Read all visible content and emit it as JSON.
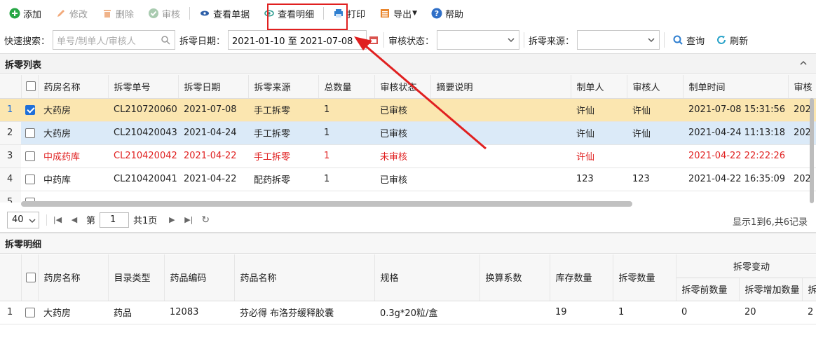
{
  "toolbar": {
    "add": "添加",
    "edit": "修改",
    "delete": "删除",
    "audit": "审核",
    "view_doc": "查看单据",
    "view_detail": "查看明细",
    "print": "打印",
    "export": "导出",
    "help": "帮助"
  },
  "search": {
    "quick_label": "快速搜索：",
    "quick_placeholder": "单号/制单人/审核人",
    "date_label": "拆零日期：",
    "date_value": "2021-01-10 至 2021-07-08",
    "status_label": "审核状态：",
    "source_label": "拆零来源：",
    "query": "查询",
    "refresh": "刷新"
  },
  "list_panel": {
    "title": "拆零列表",
    "columns": [
      "药房名称",
      "拆零单号",
      "拆零日期",
      "拆零来源",
      "总数量",
      "审核状态",
      "摘要说明",
      "制单人",
      "审核人",
      "制单时间",
      "审核"
    ],
    "rows": [
      {
        "n": "1",
        "checked": true,
        "style": "sel",
        "c": [
          "大药房",
          "CL210720060",
          "2021-07-08",
          "手工拆零",
          "1",
          "已审核",
          "",
          "许仙",
          "许仙",
          "2021-07-08 15:31:56",
          "202"
        ]
      },
      {
        "n": "2",
        "checked": false,
        "style": "hov",
        "c": [
          "大药房",
          "CL210420043",
          "2021-04-24",
          "手工拆零",
          "1",
          "已审核",
          "",
          "许仙",
          "许仙",
          "2021-04-24 11:13:18",
          "202"
        ]
      },
      {
        "n": "3",
        "checked": false,
        "style": "red",
        "c": [
          "中成药库",
          "CL210420042",
          "2021-04-22",
          "手工拆零",
          "1",
          "未审核",
          "",
          "许仙",
          "",
          "2021-04-22 22:22:26",
          ""
        ]
      },
      {
        "n": "4",
        "checked": false,
        "style": "",
        "c": [
          "中药库",
          "CL210420041",
          "2021-04-22",
          "配药拆零",
          "1",
          "已审核",
          "",
          "123",
          "123",
          "2021-04-22 16:35:09",
          "202"
        ]
      },
      {
        "n": "5",
        "checked": false,
        "style": "",
        "c": [
          "",
          "",
          "",
          "",
          "",
          "",
          "",
          "",
          "",
          "",
          ""
        ]
      }
    ]
  },
  "pager": {
    "page_size": "40",
    "page_prefix": "第",
    "page_value": "1",
    "page_suffix": "共1页",
    "info": "显示1到6,共6记录"
  },
  "detail_panel": {
    "title": "拆零明细",
    "columns": [
      "药房名称",
      "目录类型",
      "药品编码",
      "药品名称",
      "规格",
      "换算系数",
      "库存数量",
      "拆零数量"
    ],
    "group_header": "拆零变动",
    "sub_columns": [
      "拆零前数量",
      "拆零增加数量",
      "拆"
    ],
    "rows": [
      {
        "n": "1",
        "c": [
          "大药房",
          "药品",
          "12083",
          "芬必得 布洛芬缓释胶囊",
          "0.3g*20粒/盒",
          "",
          "19",
          "1",
          "0",
          "20",
          "2"
        ]
      }
    ]
  },
  "colors": {
    "accent": "#1e6fd9",
    "highlight_box": "#e02020",
    "selected_row": "#fbe6b0",
    "hover_row": "#dbeaf8",
    "unaudited_text": "#e02020"
  }
}
